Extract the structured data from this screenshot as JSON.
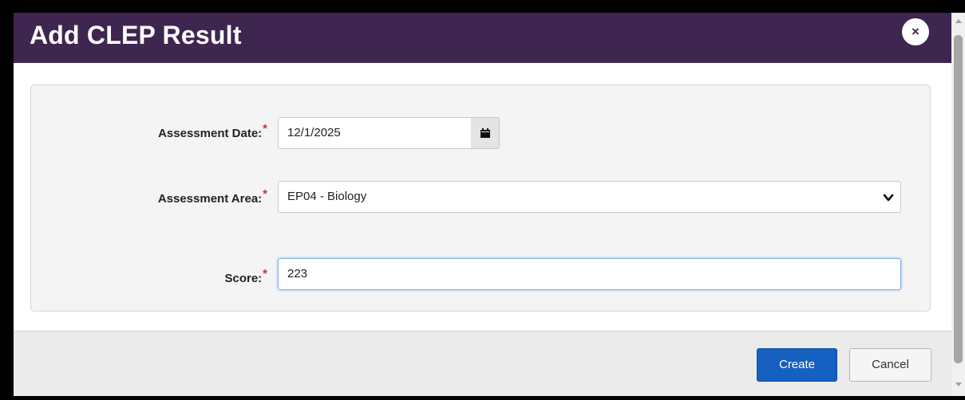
{
  "dialog": {
    "title": "Add CLEP Result",
    "close_label": "×"
  },
  "form": {
    "assessment_date": {
      "label": "Assessment Date:",
      "required_marker": "*",
      "value": "12/1/2025"
    },
    "assessment_area": {
      "label": "Assessment Area:",
      "required_marker": "*",
      "selected": "EP04 - Biology"
    },
    "score": {
      "label": "Score:",
      "required_marker": "*",
      "value": "223"
    }
  },
  "footer": {
    "create_label": "Create",
    "cancel_label": "Cancel"
  },
  "icons": {
    "close": "close-icon",
    "calendar": "calendar-icon",
    "dropdown": "chevron-down-icon"
  },
  "colors": {
    "titlebar": "#3e2650",
    "primary_button": "#1560c0",
    "required": "#d0312d"
  }
}
